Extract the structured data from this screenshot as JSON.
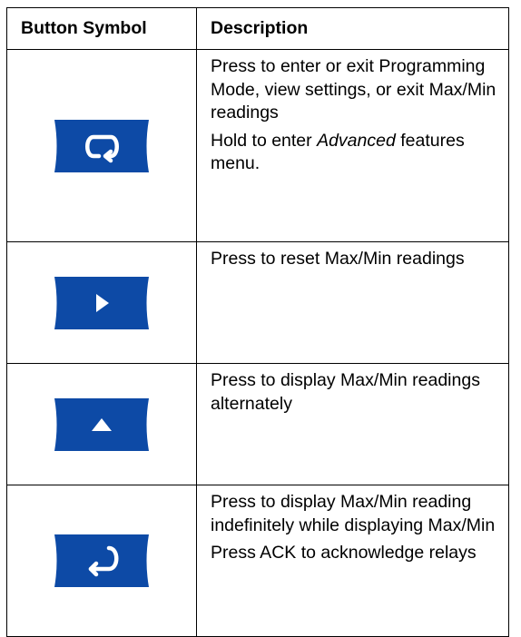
{
  "table": {
    "headers": {
      "symbol": "Button Symbol",
      "description": "Description"
    },
    "rows": [
      {
        "icon": "cycle-arrow-icon",
        "desc1": "Press to enter or exit Programming Mode, view settings, or exit Max/Min readings",
        "desc2_pre": "Hold to enter ",
        "desc2_em": "Advanced",
        "desc2_post": " features menu."
      },
      {
        "icon": "right-triangle-icon",
        "desc1": "Press to reset Max/Min readings"
      },
      {
        "icon": "up-triangle-icon",
        "desc1": "Press to display Max/Min readings alternately"
      },
      {
        "icon": "enter-return-icon",
        "desc1": "Press to display Max/Min reading indefinitely while displaying Max/Min",
        "desc2": "Press ACK to acknowledge relays"
      }
    ]
  },
  "colors": {
    "button_fill": "#0D4AA6",
    "symbol_color": "#FFFFFF",
    "border": "#000000"
  }
}
